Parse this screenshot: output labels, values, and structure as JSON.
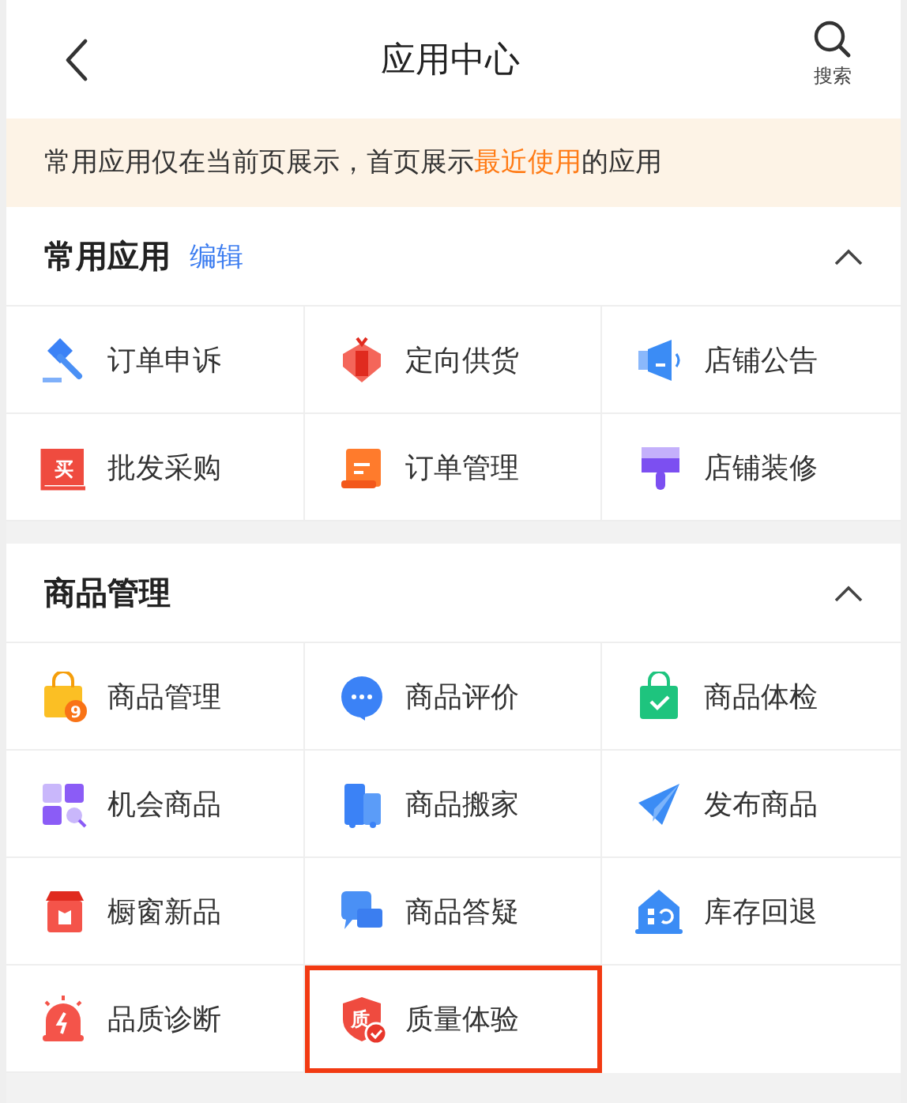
{
  "header": {
    "title": "应用中心",
    "search_label": "搜索"
  },
  "notice": "常用应用仅在当前页展示，首页展示**最近使用**的应用",
  "sections": [
    {
      "title": "常用应用",
      "action": "编辑",
      "expanded": true,
      "items": [
        {
          "label": "订单申诉",
          "highlighted": false
        },
        {
          "label": "定向供货",
          "highlighted": false
        },
        {
          "label": "店铺公告",
          "highlighted": false
        },
        {
          "label": "批发采购",
          "icon_text": "买",
          "highlighted": false
        },
        {
          "label": "订单管理",
          "highlighted": false
        },
        {
          "label": "店铺装修",
          "highlighted": false
        }
      ]
    },
    {
      "title": "商品管理",
      "expanded": true,
      "items": [
        {
          "label": "商品管理",
          "icon_text": "9",
          "highlighted": false
        },
        {
          "label": "商品评价",
          "highlighted": false
        },
        {
          "label": "商品体检",
          "highlighted": false
        },
        {
          "label": "机会商品",
          "highlighted": false
        },
        {
          "label": "商品搬家",
          "highlighted": false
        },
        {
          "label": "发布商品",
          "highlighted": false
        },
        {
          "label": "橱窗新品",
          "highlighted": false
        },
        {
          "label": "商品答疑",
          "highlighted": false
        },
        {
          "label": "库存回退",
          "highlighted": false
        },
        {
          "label": "品质诊断",
          "highlighted": false
        },
        {
          "label": "质量体验",
          "icon_text": "质",
          "highlighted": true
        }
      ]
    }
  ]
}
